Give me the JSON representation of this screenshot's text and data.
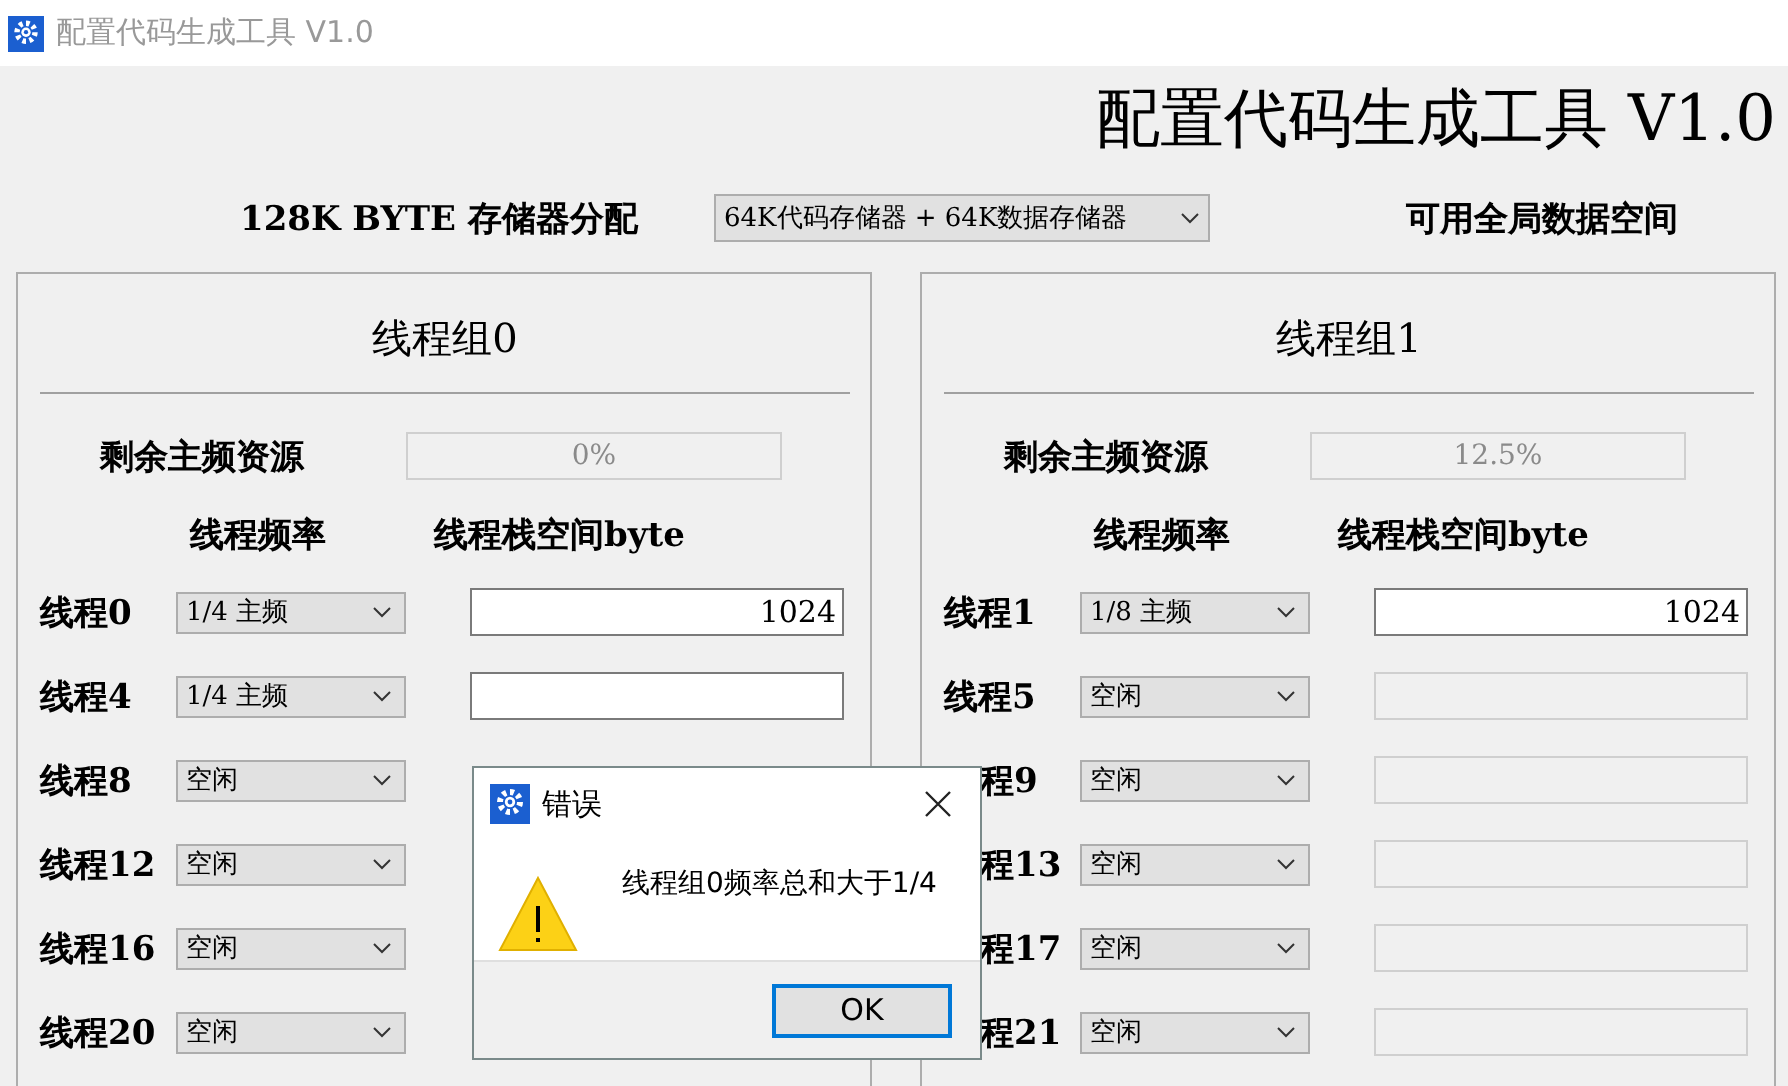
{
  "window": {
    "title": "配置代码生成工具 V1.0"
  },
  "header": {
    "title": "配置代码生成工具 V1.0",
    "memory_label": "128K BYTE 存储器分配",
    "memory_select": "64K代码存储器 + 64K数据存储器",
    "global_label": "可用全局数据空间"
  },
  "groups": [
    {
      "title": "线程组0",
      "remaining_label": "剩余主频资源",
      "remaining_value": "0%",
      "freq_header": "线程频率",
      "stack_header": "线程栈空间byte",
      "threads": [
        {
          "label": "线程0",
          "label_cut": false,
          "frequency": "1/4 主频",
          "kind": "field",
          "disabled": false,
          "stack": "1024"
        },
        {
          "label": "线程4",
          "label_cut": false,
          "frequency": "1/4 主频",
          "kind": "field",
          "disabled": false
        },
        {
          "label": "线程8",
          "label_cut": false,
          "frequency": "空闲",
          "kind": "covered"
        },
        {
          "label": "线程12",
          "label_cut": false,
          "frequency": "空闲",
          "kind": "covered"
        },
        {
          "label": "线程16",
          "label_cut": false,
          "frequency": "空闲",
          "kind": "covered"
        },
        {
          "label": "线程20",
          "label_cut": false,
          "frequency": "空闲",
          "kind": "covered"
        }
      ]
    },
    {
      "title": "线程组1",
      "remaining_label": "剩余主频资源",
      "remaining_value": "12.5%",
      "freq_header": "线程频率",
      "stack_header": "线程栈空间byte",
      "threads": [
        {
          "label": "线程1",
          "label_cut": false,
          "frequency": "1/8 主频",
          "kind": "field",
          "disabled": false,
          "stack": "1024"
        },
        {
          "label": "线程5",
          "label_cut": false,
          "frequency": "空闲",
          "kind": "field",
          "disabled": true
        },
        {
          "label": "程9",
          "label_cut": true,
          "frequency": "空闲",
          "kind": "field",
          "disabled": true
        },
        {
          "label": "程13",
          "label_cut": true,
          "frequency": "空闲",
          "kind": "field",
          "disabled": true
        },
        {
          "label": "程17",
          "label_cut": true,
          "frequency": "空闲",
          "kind": "field",
          "disabled": true
        },
        {
          "label": "程21",
          "label_cut": true,
          "frequency": "空闲",
          "kind": "field",
          "disabled": true
        }
      ]
    }
  ],
  "dialog": {
    "title": "错误",
    "message": "线程组0频率总和大于1/4",
    "ok": "OK"
  }
}
